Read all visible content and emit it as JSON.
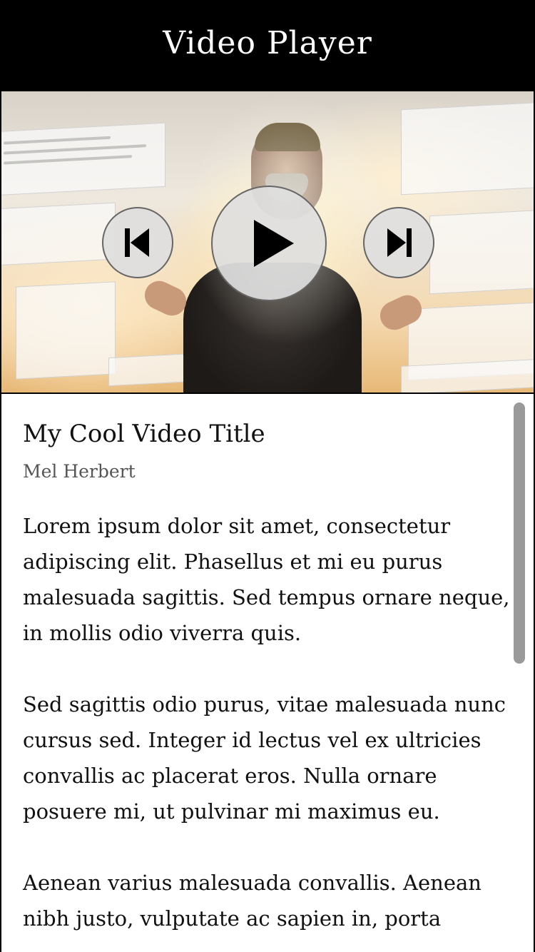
{
  "header": {
    "title": "Video Player"
  },
  "player": {
    "controls": {
      "previous_icon": "skip-previous-icon",
      "play_icon": "play-icon",
      "next_icon": "skip-next-icon"
    }
  },
  "video": {
    "title": "My Cool Video Title",
    "author": "Mel Herbert",
    "description": [
      "Lorem ipsum dolor sit amet, consectetur adipiscing elit. Phasellus et mi eu purus malesuada sagittis. Sed tempus ornare neque, in mollis odio viverra quis.",
      "Sed sagittis odio purus, vitae malesuada nunc cursus sed. Integer id lectus vel ex ultricies convallis ac placerat eros. Nulla ornare posuere mi, ut pulvinar mi maximus eu.",
      "Aenean varius malesuada convallis. Aenean nibh justo, vulputate ac sapien in, porta"
    ]
  },
  "colors": {
    "header_bg": "#000000",
    "header_text": "#ffffff",
    "control_fill": "#dedede",
    "scrollbar": "#9a9a9a"
  }
}
